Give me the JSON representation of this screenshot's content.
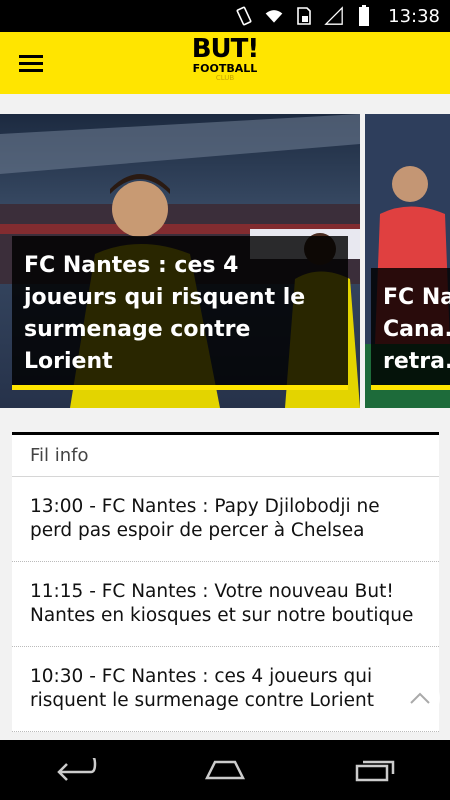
{
  "status_bar": {
    "time": "13:38",
    "icons": [
      "vibrate-icon",
      "wifi-icon",
      "sim-icon",
      "signal-icon",
      "battery-icon"
    ]
  },
  "app_bar": {
    "menu_icon": "hamburger-menu-icon",
    "logo": {
      "line1": "BUT!",
      "line2": "FOOTBALL",
      "line3": "CLUB"
    },
    "brand_color": "#ffe500"
  },
  "carousel": {
    "cards": [
      {
        "title": "FC Nantes : ces 4 joueurs qui risquent le surmenage contre Lorient"
      },
      {
        "title": "FC Na... Cana... retra..."
      }
    ]
  },
  "fil_info": {
    "heading": "Fil info",
    "items": [
      {
        "text": "13:00 - FC Nantes : Papy Djilobodji ne perd pas espoir de percer à Chelsea"
      },
      {
        "text": "11:15 - FC Nantes : Votre nouveau But! Nantes en kiosques et sur notre boutique"
      },
      {
        "text": "10:30 - FC Nantes : ces 4 joueurs qui risquent le surmenage contre Lorient"
      }
    ]
  },
  "scroll_top_icon": "chevron-up-icon",
  "nav_bar": {
    "icons": [
      "back-icon",
      "home-icon",
      "recents-icon"
    ]
  }
}
